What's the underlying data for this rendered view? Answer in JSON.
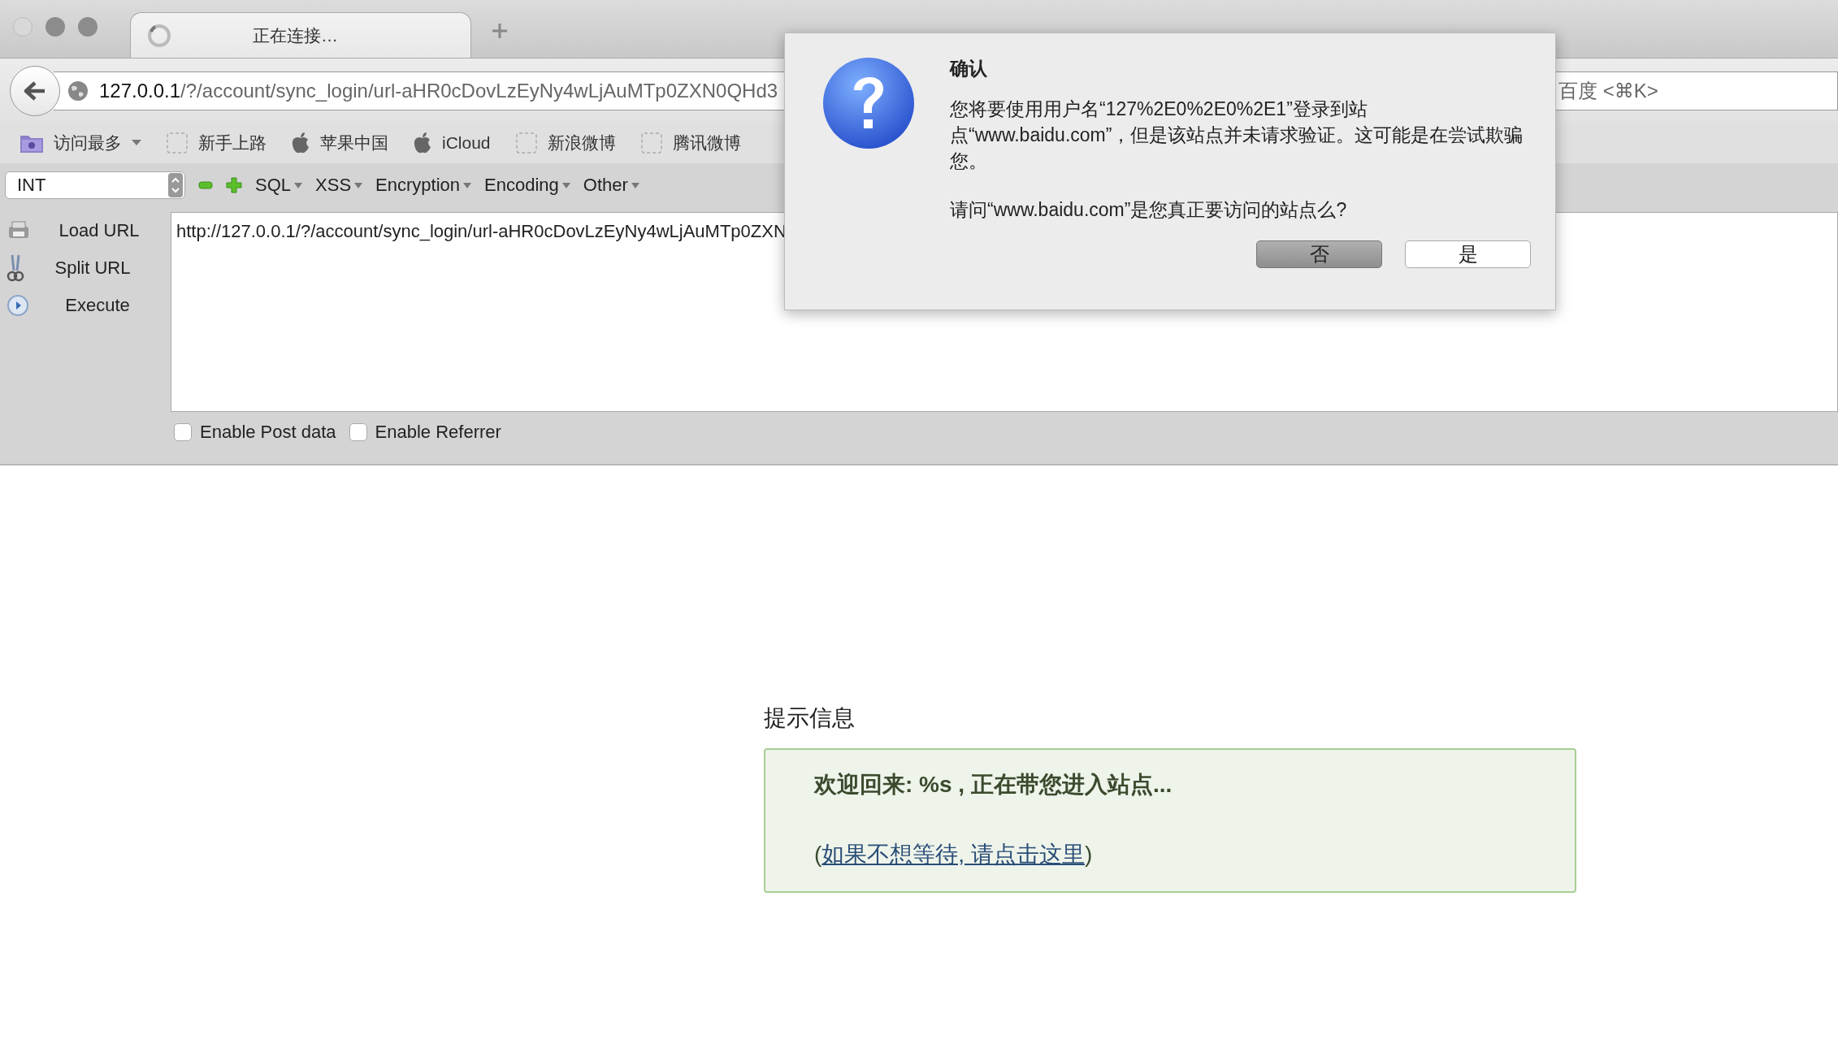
{
  "tab": {
    "title": "正在连接…"
  },
  "navigation": {
    "url_host": "127.0.0.1",
    "url_path": "/?/account/sync_login/url-aHR0cDovLzEyNy4wLjAuMTp0ZXN0QHd3",
    "search_placeholder": "百度 <⌘K>"
  },
  "bookmarks": [
    {
      "label": "访问最多",
      "kind": "folder"
    },
    {
      "label": "新手上路",
      "kind": "page"
    },
    {
      "label": "苹果中国",
      "kind": "apple"
    },
    {
      "label": "iCloud",
      "kind": "apple"
    },
    {
      "label": "新浪微博",
      "kind": "page"
    },
    {
      "label": "腾讯微博",
      "kind": "page"
    }
  ],
  "hackbar": {
    "type_select": "INT",
    "menus": [
      "SQL",
      "XSS",
      "Encryption",
      "Encoding",
      "Other"
    ],
    "actions": [
      {
        "label": "Load URL",
        "kind": "load"
      },
      {
        "label": "Split URL",
        "kind": "split"
      },
      {
        "label": "Execute",
        "kind": "execute"
      }
    ],
    "url_text": "http://127.0.0.1/?/account/sync_login/url-aHR0cDovLzEyNy4wLjAuMTp0ZXN",
    "options": [
      {
        "label": "Enable Post data",
        "checked": false
      },
      {
        "label": "Enable Referrer",
        "checked": false
      }
    ]
  },
  "page": {
    "heading": "提示信息",
    "message": "欢迎回来: %s , 正在带您进入站点...",
    "link_before": "(",
    "link": "如果不想等待, 请点击这里",
    "link_after": ")"
  },
  "dialog": {
    "title": "确认",
    "message": "您将要使用用户名“127%2E0%2E0%2E1”登录到站点“www.baidu.com”，但是该站点并未请求验证。这可能是在尝试欺骗您。",
    "question": "请问“www.baidu.com”是您真正要访问的站点么?",
    "buttons": [
      {
        "label": "否",
        "default": true
      },
      {
        "label": "是",
        "default": false
      }
    ]
  }
}
